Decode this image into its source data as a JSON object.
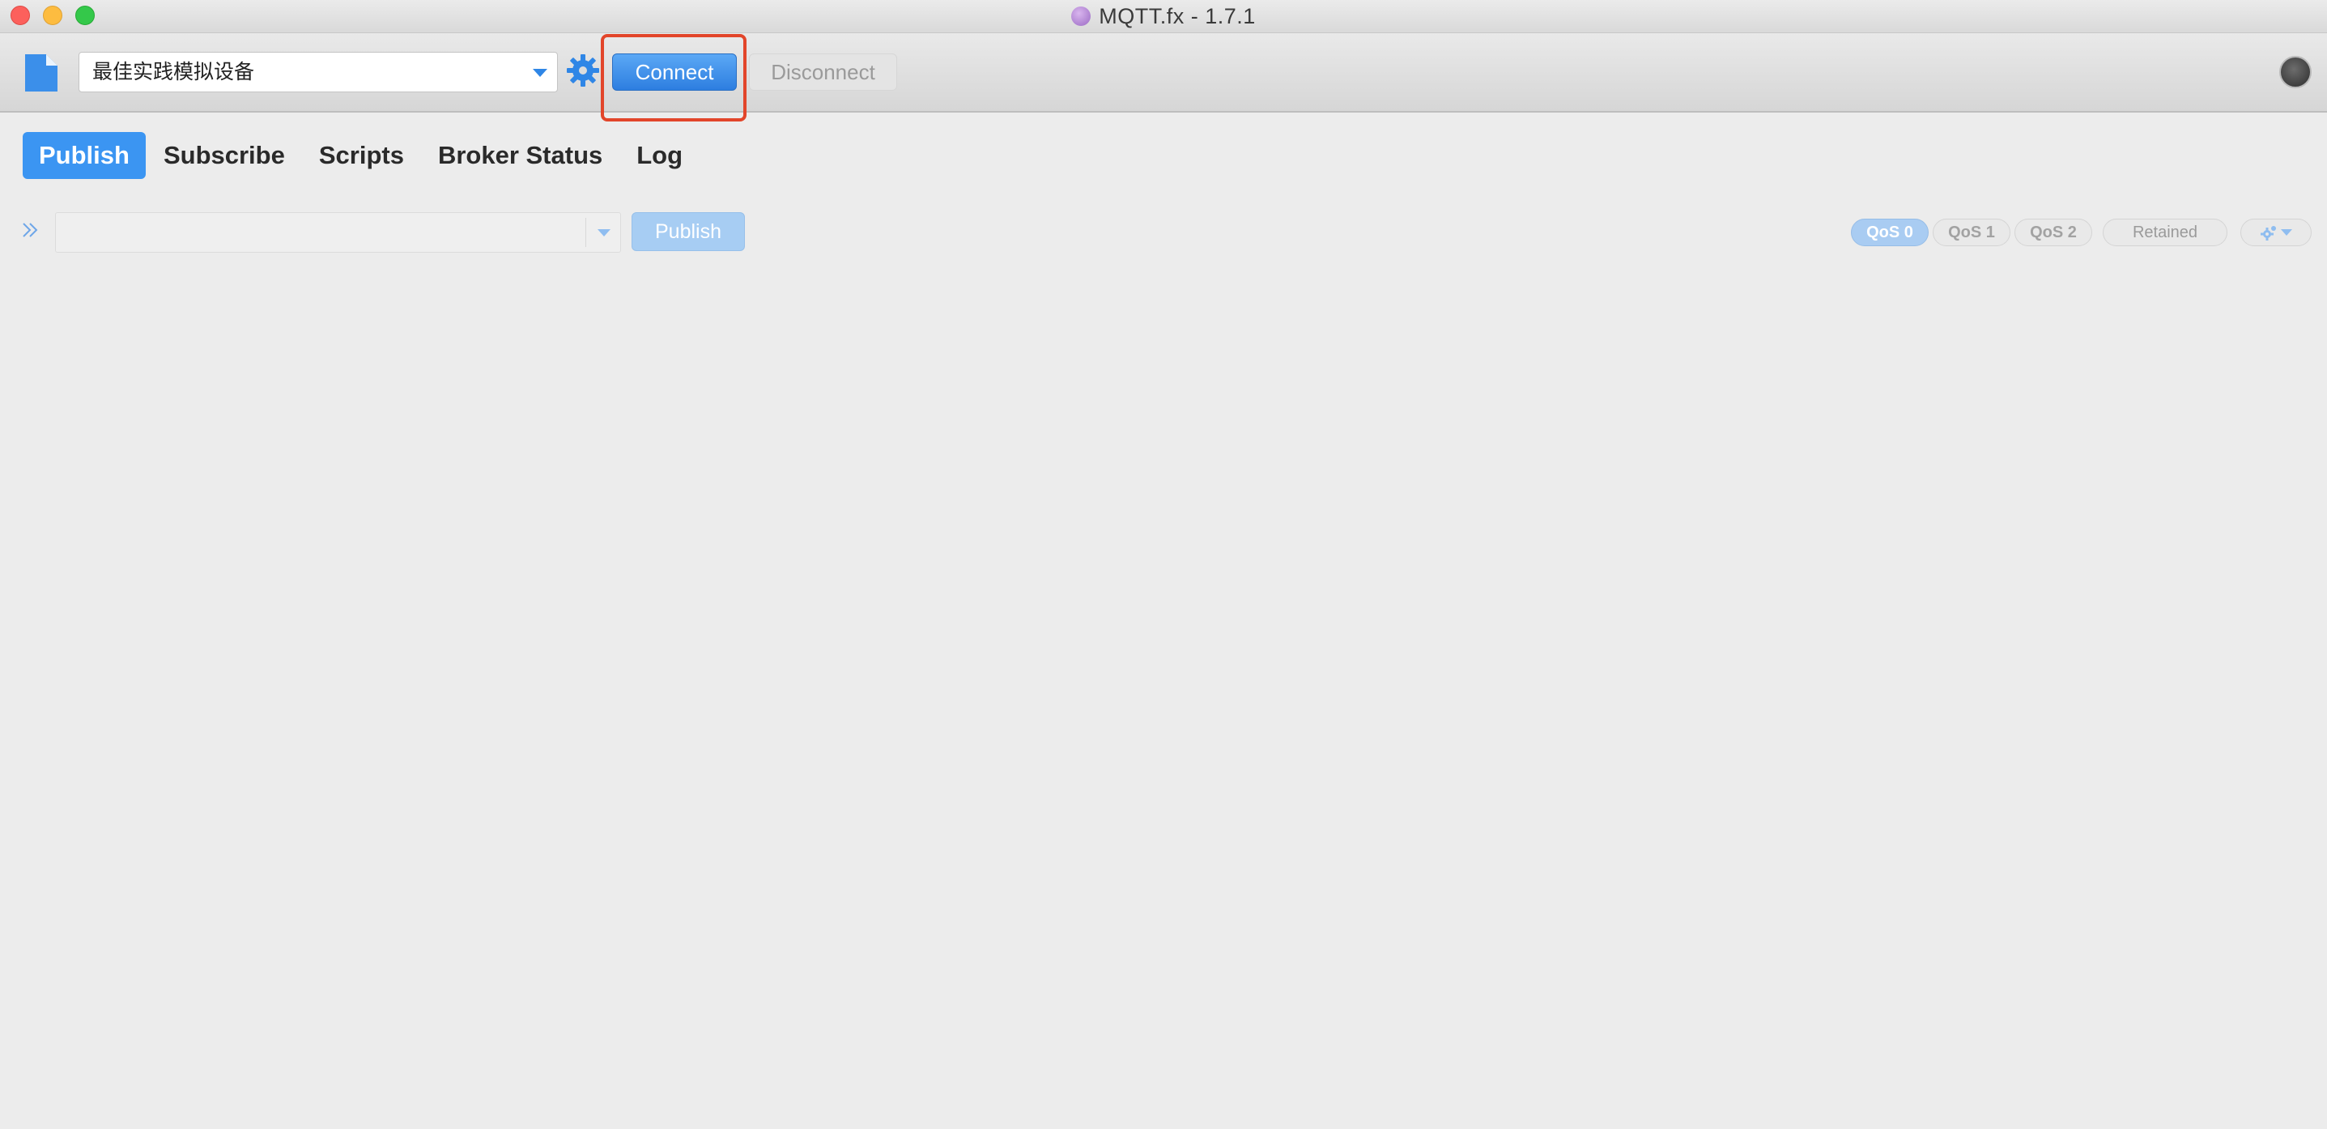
{
  "window": {
    "title": "MQTT.fx - 1.7.1"
  },
  "toolbar": {
    "profile_value": "最佳实践模拟设备",
    "connect_label": "Connect",
    "disconnect_label": "Disconnect"
  },
  "tabs": [
    {
      "label": "Publish",
      "active": true
    },
    {
      "label": "Subscribe",
      "active": false
    },
    {
      "label": "Scripts",
      "active": false
    },
    {
      "label": "Broker Status",
      "active": false
    },
    {
      "label": "Log",
      "active": false
    }
  ],
  "publish": {
    "topic_value": "",
    "publish_label": "Publish",
    "qos": [
      "QoS 0",
      "QoS 1",
      "QoS 2"
    ],
    "selected_qos": "QoS 0",
    "retained_label": "Retained"
  },
  "colors": {
    "accent": "#3b95f2",
    "highlight": "#e2452a",
    "background": "#ececec"
  },
  "icons": {
    "app": "mqttfx-app-icon",
    "document": "document-icon",
    "settings": "gear-icon",
    "expand": "double-chevron-right-icon",
    "options": "gear-options-icon"
  }
}
